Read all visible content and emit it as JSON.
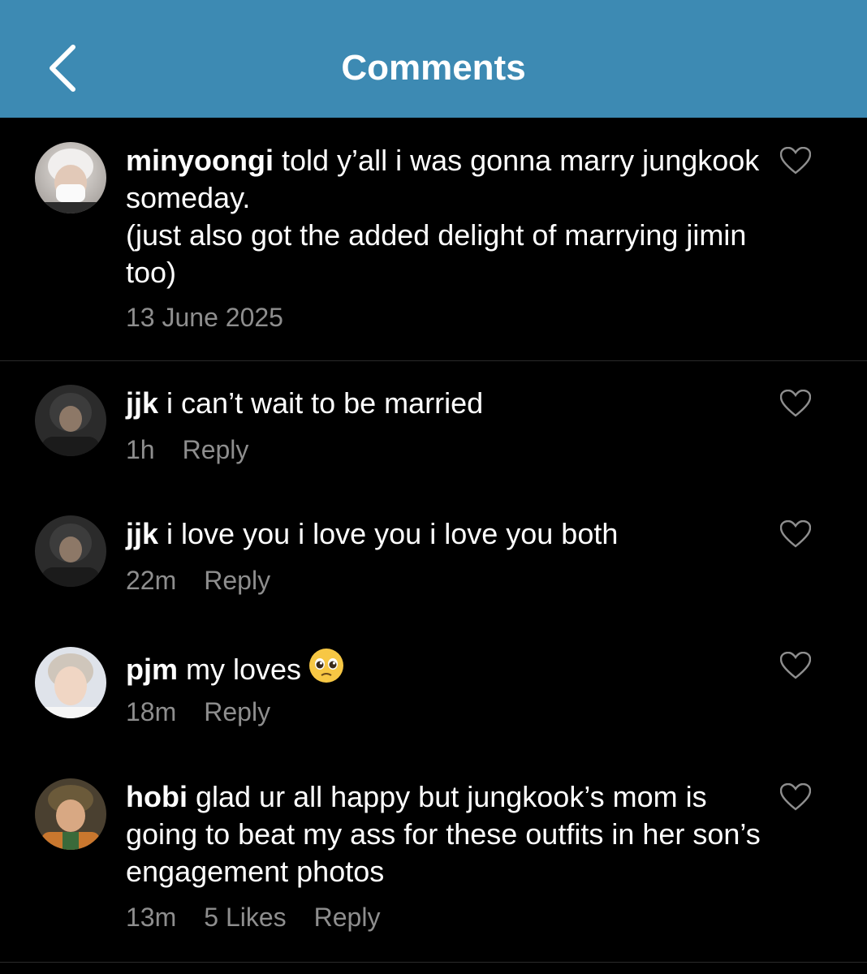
{
  "header": {
    "title": "Comments",
    "back_icon": "chevron-left-icon",
    "background": "#3d8ab3"
  },
  "caption": {
    "username": "minyoongi",
    "text": " told y’all i was gonna marry jungkook someday.\n(just also got the added delight of marrying jimin too)",
    "date": "13 June 2025"
  },
  "comments": [
    {
      "username": "jjk",
      "text": " i can’t wait to be married",
      "time": "1h",
      "reply": "Reply"
    },
    {
      "username": "jjk",
      "text": " i love you i love you i love you both",
      "time": "22m",
      "reply": "Reply"
    },
    {
      "username": "pjm",
      "text": " my loves",
      "emoji": "pleading-face-icon",
      "time": "18m",
      "reply": "Reply"
    },
    {
      "username": "hobi",
      "text": " glad ur all happy but jungkook’s mom is going to beat my ass for these outfits in her son’s engagement photos",
      "time": "13m",
      "likes": "5 Likes",
      "reply": "Reply"
    }
  ],
  "colors": {
    "meta_text": "#8e8e8e",
    "background": "#000000"
  }
}
